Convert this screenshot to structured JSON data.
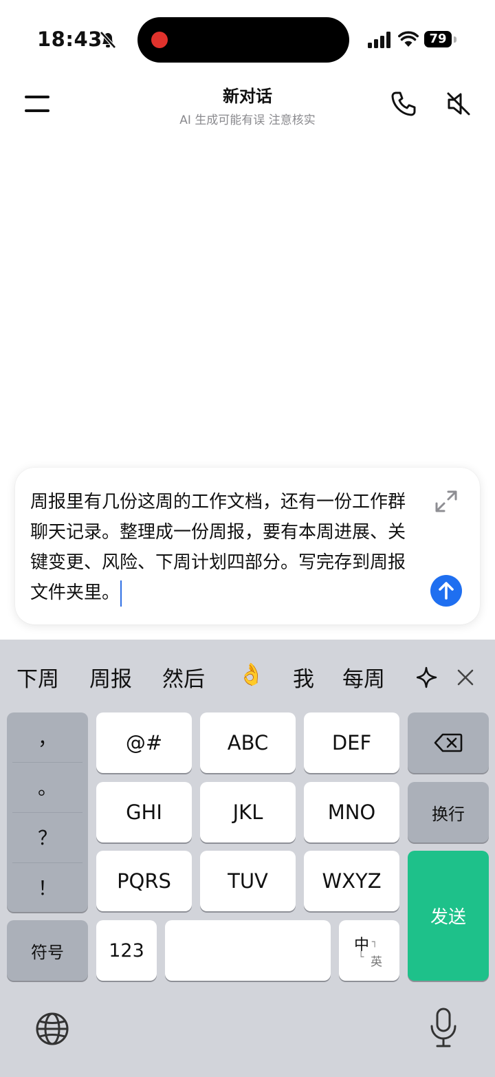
{
  "status_bar": {
    "time": "18:43",
    "battery": "79"
  },
  "header": {
    "title": "新对话",
    "subtitle": "AI 生成可能有误 注意核实"
  },
  "composer": {
    "text": "周报里有几份这周的工作文档，还有一份工作群聊天记录。整理成一份周报，要有本周进展、关键变更、风险、下周计划四部分。写完存到周报文件夹里。"
  },
  "keyboard": {
    "candidates": [
      "下周",
      "周报",
      "然后",
      "👌",
      "我",
      "每周"
    ],
    "punctuation": [
      "，",
      "。",
      "？",
      "！"
    ],
    "keys": {
      "at": "@#",
      "abc": "ABC",
      "def": "DEF",
      "ghi": "GHI",
      "jkl": "JKL",
      "mno": "MNO",
      "pqrs": "PQRS",
      "tuv": "TUV",
      "wxyz": "WXYZ",
      "newline": "换行",
      "symbols": "符号",
      "num": "123",
      "lang_top": "中",
      "lang_bottom": "英",
      "send": "发送"
    },
    "accent_color": "#1ec18a"
  }
}
